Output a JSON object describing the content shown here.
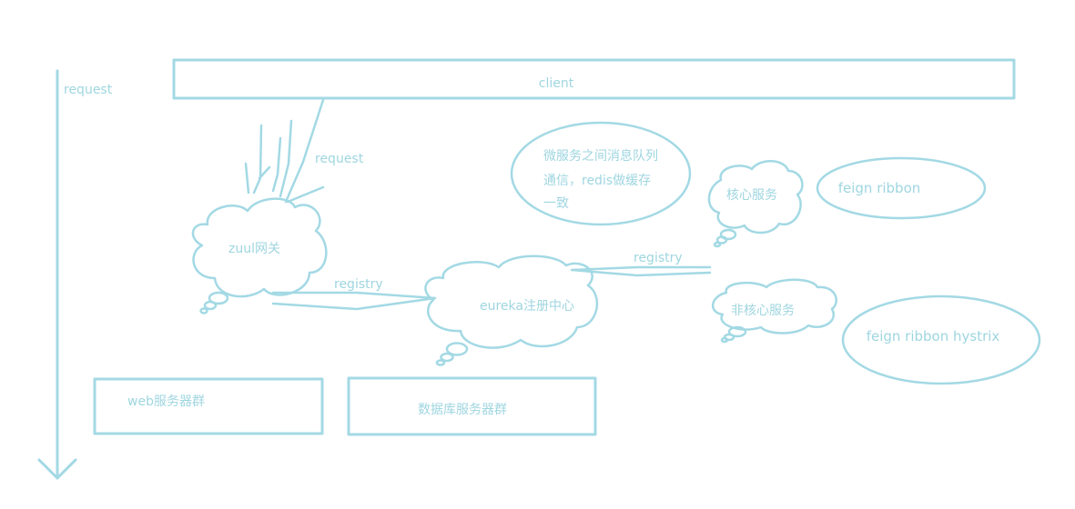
{
  "colors": {
    "stroke": "#a3d9e4",
    "text": "#9fd6e0",
    "background": "#ffffff"
  },
  "labels": {
    "request_axis": "request",
    "client": "client",
    "request_arrow": "request",
    "zuul": "zuul网关",
    "registry_left": "registry",
    "eureka": "eureka注册中心",
    "registry_right": "registry",
    "message_note": [
      "微服务之间消息队列",
      "通信，redis做缓存",
      "一致"
    ],
    "core_service": "核心服务",
    "feign_ribbon": "feign ribbon",
    "non_core_service": "非核心服务",
    "feign_ribbon_hystrix": "feign ribbon hystrix",
    "web_cluster": "web服务器群",
    "db_cluster": "数据库服务器群"
  }
}
